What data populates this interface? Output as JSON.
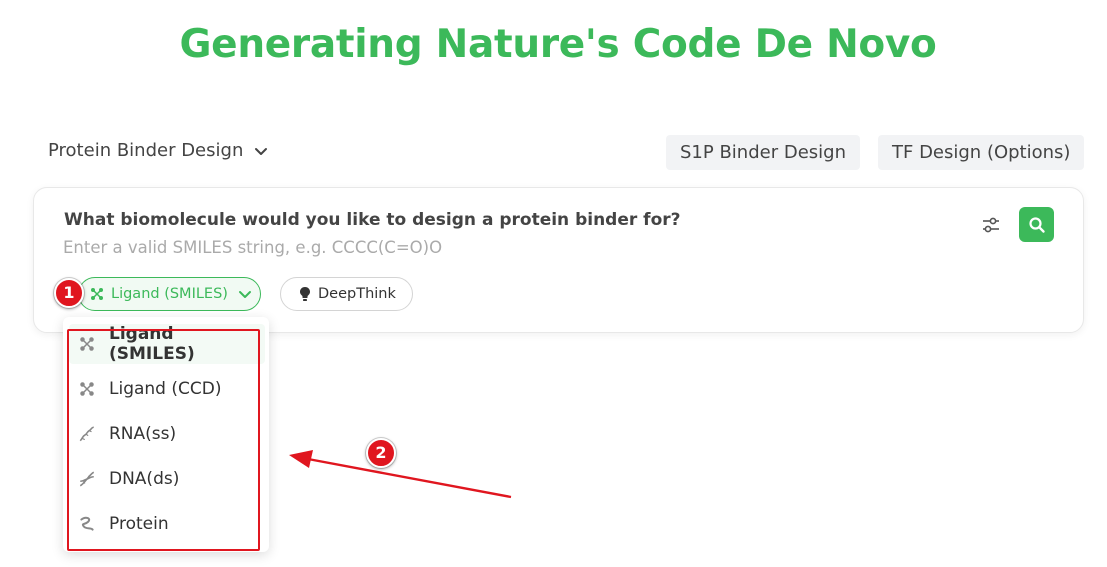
{
  "page": {
    "title": "Generating Nature's Code De Novo"
  },
  "header": {
    "mode_select_label": "Protein Binder Design",
    "s1p_button": "S1P Binder Design",
    "tf_button": "TF Design (Options)"
  },
  "query": {
    "question": "What biomolecule would you like to design a protein binder for?",
    "placeholder": "Enter a valid SMILES string, e.g. CCCC(C=O)O",
    "value": ""
  },
  "pills": {
    "ligand_label": "Ligand (SMILES)",
    "deepthink_label": "DeepThink"
  },
  "menu": {
    "items": [
      {
        "label": "Ligand (SMILES)",
        "icon": "molecule-icon",
        "selected": true
      },
      {
        "label": "Ligand (CCD)",
        "icon": "molecule-icon",
        "selected": false
      },
      {
        "label": "RNA(ss)",
        "icon": "rna-icon",
        "selected": false
      },
      {
        "label": "DNA(ds)",
        "icon": "dna-icon",
        "selected": false
      },
      {
        "label": "Protein",
        "icon": "protein-icon",
        "selected": false
      }
    ]
  },
  "annotations": {
    "badge1": "1",
    "badge2": "2"
  },
  "colors": {
    "accent": "#3cb95a",
    "annotation": "#e0161f"
  }
}
